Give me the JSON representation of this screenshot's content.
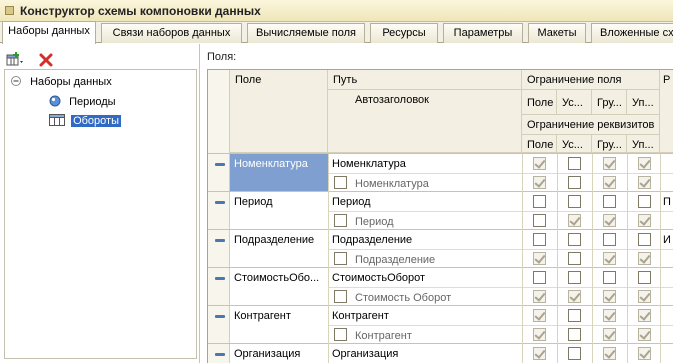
{
  "window": {
    "title": "Конструктор схемы компоновки данных"
  },
  "tabs": [
    {
      "label": "Наборы данных",
      "active": true
    },
    {
      "label": "Связи наборов данных"
    },
    {
      "label": "Вычисляемые поля"
    },
    {
      "label": "Ресурсы"
    },
    {
      "label": "Параметры"
    },
    {
      "label": "Макеты"
    },
    {
      "label": "Вложенные сх"
    }
  ],
  "toolbar": {
    "add_icon": "add-dataset-icon",
    "delete_icon": "delete-icon"
  },
  "tree": {
    "root": "Наборы данных",
    "children": [
      "Периоды",
      "Обороты"
    ],
    "selected": "Обороты"
  },
  "fields_label": "Поля:",
  "grid": {
    "headers": {
      "field": "Поле",
      "path": "Путь",
      "autotitle": "Автозаголовок",
      "field_restriction": "Ограничение поля",
      "attr_restriction": "Ограничение реквизитов",
      "sub": [
        "Поле",
        "Ус...",
        "Гру...",
        "Уп..."
      ],
      "extra": "Р"
    },
    "rows": [
      {
        "field": "Номенклатура",
        "path": "Номенклатура",
        "title": "Номенклатура",
        "auto": false,
        "fr": [
          true,
          false,
          true,
          true
        ],
        "ar": [
          true,
          false,
          true,
          true
        ],
        "extra": "",
        "selected": true
      },
      {
        "field": "Период",
        "path": "Период",
        "title": "Период",
        "auto": false,
        "fr": [
          false,
          false,
          false,
          false
        ],
        "ar": [
          false,
          true,
          true,
          true
        ],
        "extra": "П"
      },
      {
        "field": "Подразделение",
        "path": "Подразделение",
        "title": "Подразделение",
        "auto": false,
        "fr": [
          false,
          false,
          false,
          false
        ],
        "ar": [
          true,
          false,
          true,
          true
        ],
        "extra": "И"
      },
      {
        "field": "СтоимостьОбо...",
        "path": "СтоимостьОборот",
        "title": "Стоимость Оборот",
        "auto": false,
        "fr": [
          false,
          false,
          false,
          false
        ],
        "ar": [
          true,
          true,
          true,
          true
        ],
        "extra": ""
      },
      {
        "field": "Контрагент",
        "path": "Контрагент",
        "title": "Контрагент",
        "auto": false,
        "fr": [
          true,
          false,
          true,
          true
        ],
        "ar": [
          true,
          false,
          true,
          true
        ],
        "extra": ""
      },
      {
        "field": "Организация",
        "path": "Организация",
        "title": "",
        "auto": false,
        "fr": [
          true,
          false,
          true,
          true
        ],
        "ar": [],
        "extra": ""
      }
    ]
  }
}
